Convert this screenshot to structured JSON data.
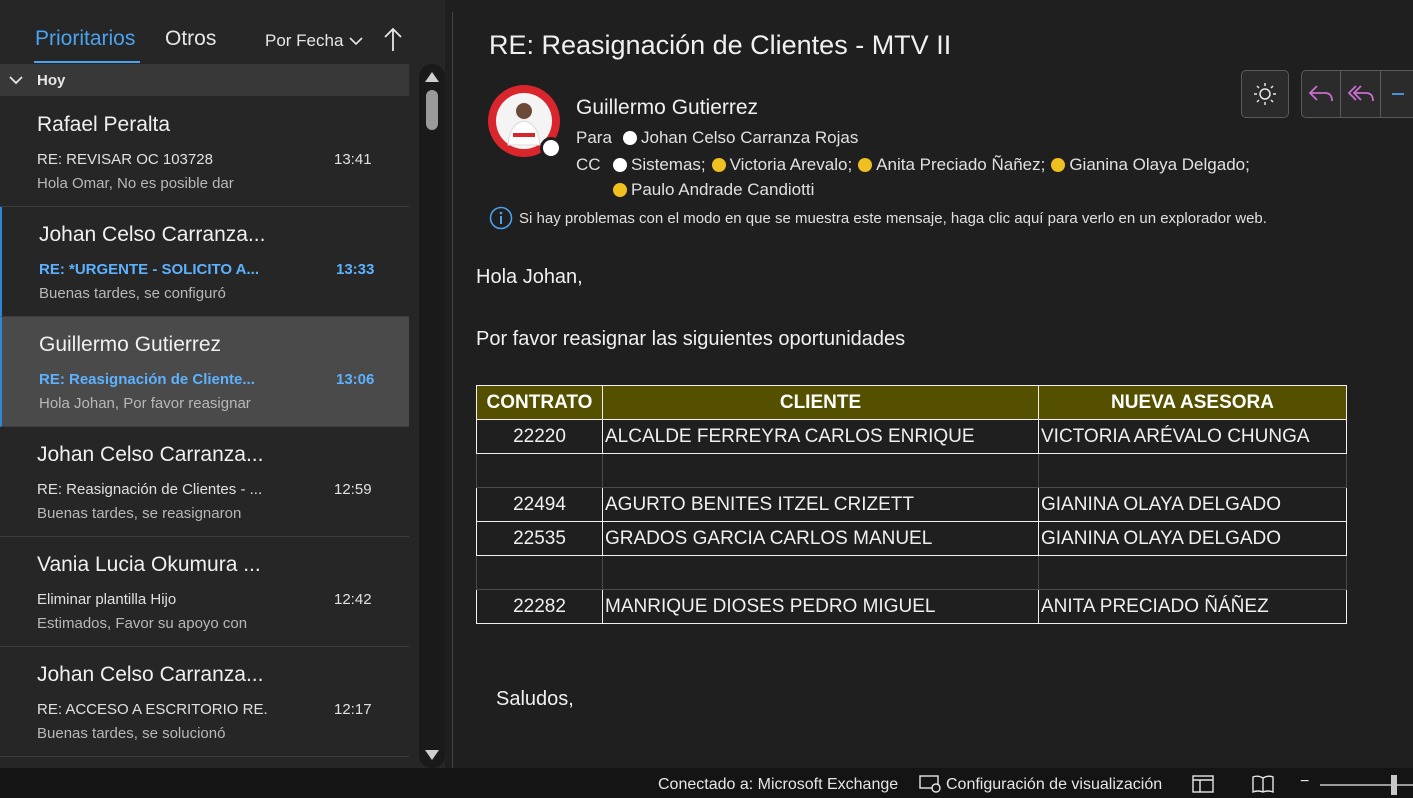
{
  "header": {
    "tab_focused": "Prioritarios",
    "tab_other": "Otros",
    "sort_label": "Por Fecha",
    "group_label": "Hoy"
  },
  "messages": [
    {
      "sender": "Rafael Peralta",
      "subject": "RE: REVISAR OC 103728",
      "time": "13:41",
      "preview": "Hola Omar,  No es posible dar"
    },
    {
      "sender": "Johan Celso Carranza...",
      "subject": "RE: *URGENTE - SOLICITO A...",
      "time": "13:33",
      "preview": "Buenas tardes, se configuró"
    },
    {
      "sender": "Guillermo Gutierrez",
      "subject": "RE: Reasignación de Cliente...",
      "time": "13:06",
      "preview": "Hola Johan,  Por favor reasignar"
    },
    {
      "sender": "Johan Celso Carranza...",
      "subject": "RE: Reasignación de Clientes - ...",
      "time": "12:59",
      "preview": "Buenas tardes, se reasignaron"
    },
    {
      "sender": "Vania Lucia Okumura ...",
      "subject": "Eliminar plantilla Hijo",
      "time": "12:42",
      "preview": "Estimados,   Favor su apoyo con"
    },
    {
      "sender": "Johan Celso Carranza...",
      "subject": "RE: ACCESO A ESCRITORIO RE...",
      "time": "12:17",
      "preview": "Buenas tardes, se solucionó"
    }
  ],
  "mail": {
    "subject": "RE: Reasignación de Clientes - MTV II",
    "from": "Guillermo Gutierrez",
    "to_label": "Para",
    "to": "Johan Celso Carranza Rojas",
    "cc_label": "CC",
    "cc": [
      "Sistemas;",
      "Victoria Arevalo;",
      "Anita Preciado Ñañez;",
      "Gianina Olaya Delgado;",
      "Paulo Andrade Candiotti"
    ],
    "info": "Si hay problemas con el modo en que se muestra este mensaje, haga clic aquí para verlo en un explorador web.",
    "greeting": "Hola Johan,",
    "intro": "Por favor reasignar las siguientes oportunidades",
    "closing": "Saludos,"
  },
  "table": {
    "headers": [
      "CONTRATO",
      "CLIENTE",
      "NUEVA ASESORA"
    ],
    "rows": [
      [
        "22220",
        "ALCALDE FERREYRA CARLOS ENRIQUE",
        "VICTORIA ARÉVALO CHUNGA"
      ],
      [
        "",
        "",
        ""
      ],
      [
        "22494",
        "AGURTO BENITES ITZEL CRIZETT",
        "GIANINA OLAYA DELGADO"
      ],
      [
        "22535",
        "GRADOS GARCIA CARLOS MANUEL",
        "GIANINA OLAYA DELGADO"
      ],
      [
        "",
        "",
        ""
      ],
      [
        "22282",
        "MANRIQUE DIOSES PEDRO  MIGUEL",
        "ANITA PRECIADO ÑÁÑEZ"
      ]
    ]
  },
  "status": {
    "connection": "Conectado a: Microsoft Exchange",
    "display_settings": "Configuración de visualización"
  },
  "colors": {
    "accent": "#4aa3f0",
    "unread": "#5db1ff",
    "table_header": "#545000",
    "presence_yellow": "#f0c020",
    "reply_icon": "#c86fd0"
  }
}
